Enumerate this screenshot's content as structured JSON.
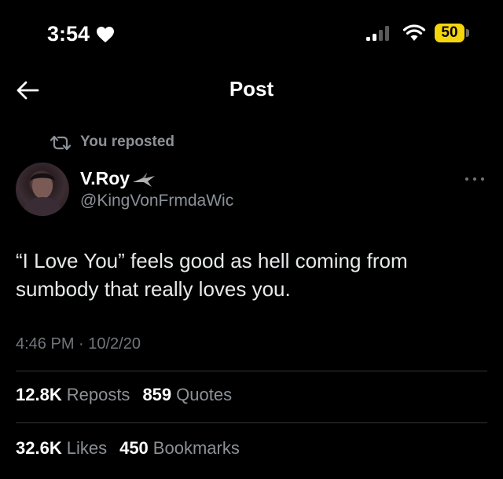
{
  "status_bar": {
    "time": "3:54",
    "battery": "50"
  },
  "header": {
    "title": "Post"
  },
  "repost": {
    "text": "You reposted"
  },
  "author": {
    "name": "V.Roy",
    "handle": "@KingVonFrmdaWic"
  },
  "tweet": {
    "text": "“I Love You” feels good as hell coming from sumbody that really loves you.",
    "timestamp": "4:46 PM · 10/2/20"
  },
  "stats": {
    "reposts": {
      "count": "12.8K",
      "label": "Reposts"
    },
    "quotes": {
      "count": "859",
      "label": "Quotes"
    },
    "likes": {
      "count": "32.6K",
      "label": "Likes"
    },
    "bookmarks": {
      "count": "450",
      "label": "Bookmarks"
    }
  },
  "colors": {
    "background": "#000000",
    "primary_text": "#e7e9ea",
    "secondary_text": "#8b9197",
    "battery": "#f5d60a"
  },
  "icons": [
    "heart-icon",
    "signal-icon",
    "wifi-icon",
    "back-arrow-icon",
    "repost-icon",
    "bird-emoji-icon",
    "more-icon"
  ]
}
